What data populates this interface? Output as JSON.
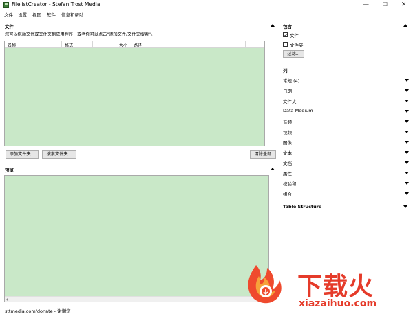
{
  "window": {
    "title": "FilelistCreator - Stefan Trost Media",
    "minimize_icon": "minimize-icon",
    "maximize_icon": "maximize-icon",
    "close_icon": "close-icon"
  },
  "menu": {
    "items": [
      "文件",
      "设置",
      "视图",
      "软件",
      "信息和帮助"
    ]
  },
  "files_panel": {
    "title": "文件",
    "hint": "您可以拖动文件或文件夹到应用程序，或者你可以点击\"添加文件/文件夹搜索\"。",
    "columns": [
      "名称",
      "格式",
      "大小",
      "路径"
    ],
    "rows": [],
    "buttons": {
      "add_folder": "添加文件夹...",
      "search_folder": "搜索文件夹...",
      "clear_all": "清除全部"
    }
  },
  "preview_panel": {
    "title": "预览"
  },
  "status": {
    "text": "sttmedia.com/donate - 谢谢您"
  },
  "include_panel": {
    "title": "包含",
    "checkboxes": [
      {
        "label": "文件",
        "checked": true
      },
      {
        "label": "文件夹",
        "checked": false
      }
    ],
    "filter_button": "过滤..."
  },
  "columns_panel": {
    "title": "列",
    "groups": [
      "常规 (4)",
      "日期",
      "文件夹",
      "Data Medium",
      "音频",
      "视频",
      "图像",
      "文本",
      "文档",
      "属性",
      "校验和",
      "组合"
    ]
  },
  "table_structure": {
    "title": "Table Structure"
  },
  "watermark": {
    "cn": "下载火",
    "en": "xiazaihuo.com"
  },
  "colors": {
    "list_bg": "#c9e8c8",
    "watermark": "#e53b2a"
  }
}
